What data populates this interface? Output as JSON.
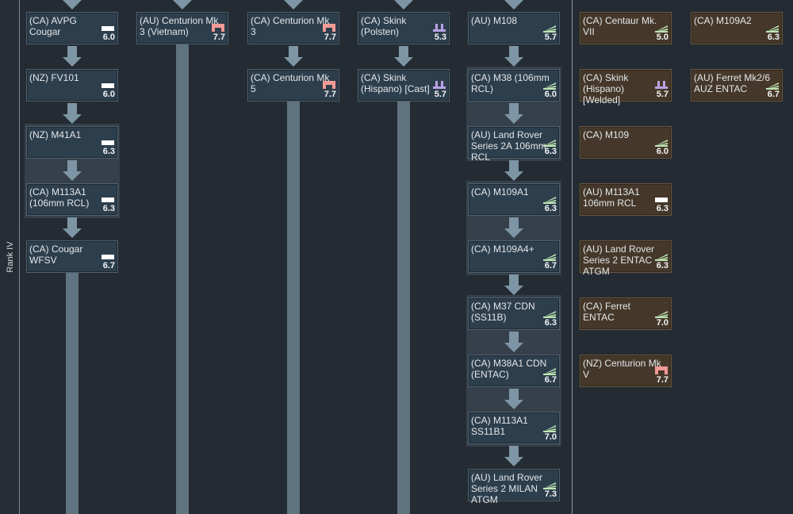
{
  "rank": {
    "label": "Rank IV"
  },
  "columns": [
    {
      "vehicles": [
        {
          "name": "(CA) AVPG Cougar",
          "br": "6.0",
          "type": "light-tank-icon",
          "premium": false
        },
        {
          "name": "(NZ) FV101",
          "br": "6.0",
          "type": "light-tank-icon",
          "premium": false
        },
        {
          "name": "(NZ) M41A1",
          "br": "6.3",
          "type": "light-tank-icon",
          "premium": false
        },
        {
          "name": "(CA) M113A1\n(106mm RCL)",
          "br": "6.3",
          "type": "light-tank-icon",
          "premium": false
        },
        {
          "name": "(CA) Cougar\nWFSV",
          "br": "6.7",
          "type": "light-tank-icon",
          "premium": false
        }
      ]
    },
    {
      "vehicles": [
        {
          "name": "(AU) Centurion Mk\n3 (Vietnam)",
          "br": "7.7",
          "type": "heavy-tank-icon",
          "premium": false
        }
      ]
    },
    {
      "vehicles": [
        {
          "name": "(CA) Centurion Mk\n3",
          "br": "7.7",
          "type": "heavy-tank-icon",
          "premium": false
        },
        {
          "name": "(CA) Centurion Mk\n5",
          "br": "7.7",
          "type": "heavy-tank-icon",
          "premium": false
        }
      ]
    },
    {
      "vehicles": [
        {
          "name": "(CA) Skink\n(Polsten)",
          "br": "5.3",
          "type": "spaa-icon",
          "premium": false
        },
        {
          "name": "(CA) Skink\n(Hispano) [Cast]",
          "br": "5.7",
          "type": "spaa-icon",
          "premium": false
        }
      ]
    },
    {
      "vehicles": [
        {
          "name": "(AU) M108",
          "br": "5.7",
          "type": "tank-destroyer-icon",
          "premium": false
        },
        {
          "name": "(CA) M38 (106mm\nRCL)",
          "br": "6.0",
          "type": "tank-destroyer-icon",
          "premium": false
        },
        {
          "name": "(AU) Land Rover\nSeries 2A 106mm\nRCL",
          "br": "6.3",
          "type": "tank-destroyer-icon",
          "premium": false
        },
        {
          "name": "(CA) M109A1",
          "br": "6.3",
          "type": "tank-destroyer-icon",
          "premium": false
        },
        {
          "name": "(CA) M109A4+",
          "br": "6.7",
          "type": "tank-destroyer-icon",
          "premium": false
        },
        {
          "name": "(CA) M37 CDN\n(SS11B)",
          "br": "6.3",
          "type": "tank-destroyer-icon",
          "premium": false
        },
        {
          "name": "(CA) M38A1 CDN\n(ENTAC)",
          "br": "6.7",
          "type": "tank-destroyer-icon",
          "premium": false
        },
        {
          "name": "(CA) M113A1\nSS11B1",
          "br": "7.0",
          "type": "tank-destroyer-icon",
          "premium": false
        },
        {
          "name": "(AU) Land Rover\nSeries 2 MILAN\nATGM",
          "br": "7.3",
          "type": "tank-destroyer-icon",
          "premium": false
        }
      ]
    },
    {
      "vehicles": [
        {
          "name": "(CA) Centaur Mk.\nVII",
          "br": "5.0",
          "type": "tank-destroyer-icon",
          "premium": true
        },
        {
          "name": "(CA) Skink\n(Hispano) [Welded]",
          "br": "5.7",
          "type": "spaa-icon",
          "premium": true
        },
        {
          "name": "(CA) M109",
          "br": "6.0",
          "type": "tank-destroyer-icon",
          "premium": true
        },
        {
          "name": "(AU) M113A1\n106mm RCL",
          "br": "6.3",
          "type": "light-tank-icon",
          "premium": true
        },
        {
          "name": "(AU) Land Rover\nSeries 2 ENTAC\nATGM",
          "br": "6.3",
          "type": "tank-destroyer-icon",
          "premium": true
        },
        {
          "name": "(CA) Ferret ENTAC",
          "br": "7.0",
          "type": "tank-destroyer-icon",
          "premium": true
        },
        {
          "name": "(NZ) Centurion Mk\nV",
          "br": "7.7",
          "type": "heavy-tank-icon",
          "premium": true
        }
      ]
    },
    {
      "vehicles": [
        {
          "name": "(CA) M109A2",
          "br": "6.3",
          "type": "tank-destroyer-icon",
          "premium": true
        },
        {
          "name": "(AU) Ferret Mk2/6\nAUZ ENTAC",
          "br": "6.7",
          "type": "tank-destroyer-icon",
          "premium": true
        }
      ]
    }
  ],
  "colors": {
    "background": "#242b32",
    "card_researchable": "#2d3e4c",
    "card_premium": "#45382a",
    "light_tank_icon": "#ffffff",
    "heavy_tank_icon": "#f29a96",
    "spaa_icon": "#b9a2e6",
    "tank_destroyer_icon": "#bfe6b3"
  }
}
